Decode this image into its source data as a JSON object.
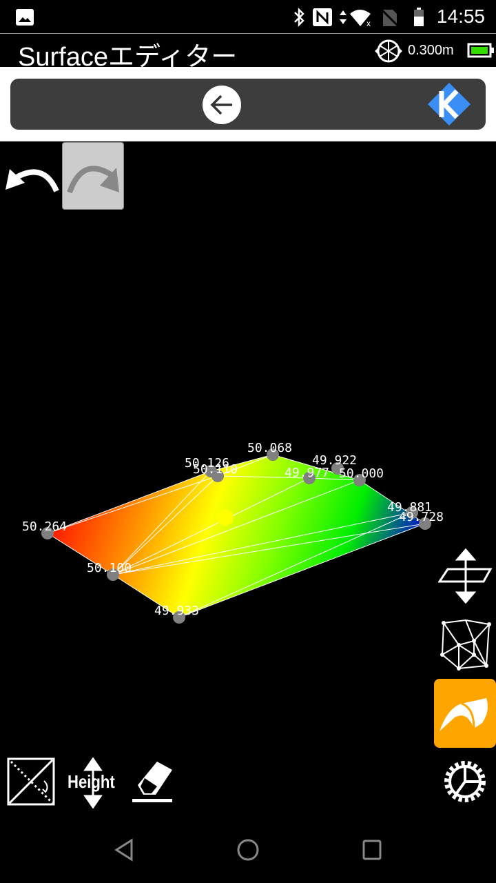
{
  "status_bar": {
    "time": "14:55",
    "icons": [
      "gallery-icon",
      "bluetooth-icon",
      "nfc-icon",
      "data-arrows-icon",
      "wifi-no-internet-icon",
      "no-sim-icon",
      "battery-icon"
    ]
  },
  "title_bar": {
    "title": "Surfaceエディター",
    "range_value": "0.300m",
    "battery_color": "#33dd00"
  },
  "toolbar": {
    "back_icon": "arrow-left-circle-icon",
    "logo_icon": "k-logo-icon"
  },
  "edit": {
    "undo_icon": "undo-icon",
    "redo_icon": "redo-icon"
  },
  "surface": {
    "points": [
      {
        "label": "50.264"
      },
      {
        "label": "50.126"
      },
      {
        "label": "50.110"
      },
      {
        "label": "50.068"
      },
      {
        "label": "49.922"
      },
      {
        "label": "49.977"
      },
      {
        "label": "50.000"
      },
      {
        "label": "49.881"
      },
      {
        "label": "49.728"
      },
      {
        "label": "50.100"
      },
      {
        "label": "49.933"
      }
    ],
    "gradient_colors": [
      "#ff2000",
      "#ffa000",
      "#ffff00",
      "#80ff00",
      "#00ee00",
      "#0020c0"
    ]
  },
  "side_tools": {
    "move_plane": "move-plane-icon",
    "mesh": "triangulation-mesh-icon",
    "surface": "surface-icon",
    "surface_active_color": "#ffa500",
    "settings": "gear-icon"
  },
  "bottom_tools": {
    "split": "split-diagonal-icon",
    "height_label": "Height",
    "eraser": "eraser-icon"
  }
}
